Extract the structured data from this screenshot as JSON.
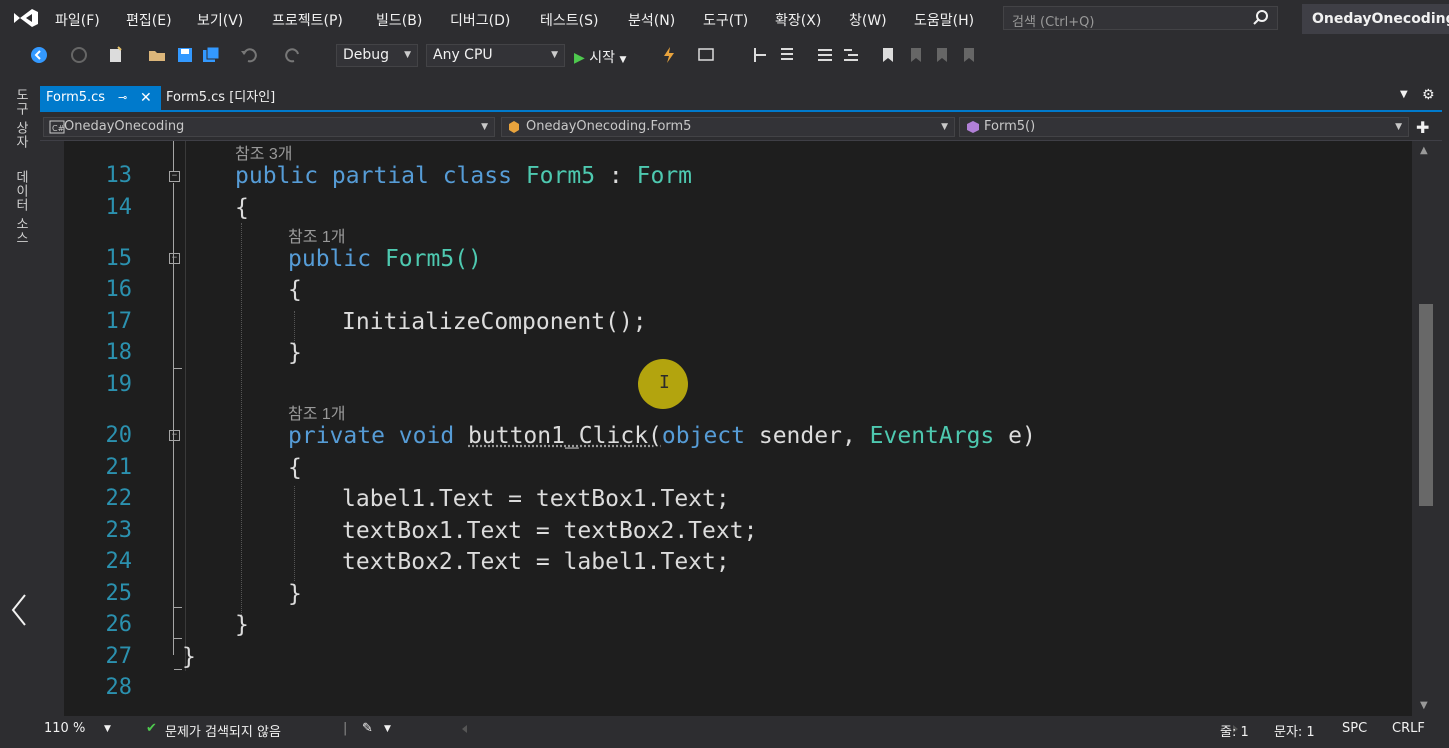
{
  "menubar": {
    "items": [
      "파일(F)",
      "편집(E)",
      "보기(V)",
      "프로젝트(P)",
      "빌드(B)",
      "디버그(D)",
      "테스트(S)",
      "분석(N)",
      "도구(T)",
      "확장(X)",
      "창(W)",
      "도움말(H)"
    ],
    "search_placeholder": "검색 (Ctrl+Q)",
    "project_name": "OnedayOnecoding"
  },
  "toolbar": {
    "config": "Debug",
    "platform": "Any CPU",
    "start_label": "시작"
  },
  "side_tabs": [
    "도구 상자",
    "데이터 소스"
  ],
  "tabs": {
    "active": "Form5.cs",
    "inactive": "Form5.cs [디자인]"
  },
  "navbar": {
    "project": "OnedayOnecoding",
    "class": "OnedayOnecoding.Form5",
    "member": "Form5()"
  },
  "editor": {
    "lines": [
      {
        "num": "13",
        "ref": "참조 3개"
      },
      {
        "num": "14"
      },
      {
        "num": "15",
        "ref": "참조 1개"
      },
      {
        "num": "16"
      },
      {
        "num": "17"
      },
      {
        "num": "18"
      },
      {
        "num": "19"
      },
      {
        "num": "20",
        "ref": "참조 1개"
      },
      {
        "num": "21"
      },
      {
        "num": "22"
      },
      {
        "num": "23"
      },
      {
        "num": "24"
      },
      {
        "num": "25"
      },
      {
        "num": "26"
      },
      {
        "num": "27"
      },
      {
        "num": "28"
      }
    ],
    "code": {
      "l13_kw": "public partial class",
      "l13_name": "Form5",
      "l13_colon": ":",
      "l13_base": "Form",
      "l14": "{",
      "l15_kw": "public",
      "l15_rest": "Form5()",
      "l16": "{",
      "l17": "InitializeComponent();",
      "l18": "}",
      "l20_kw": "private void",
      "l20_name": "button1_Click(",
      "l20_type1": "object",
      "l20_p1": "sender,",
      "l20_type2": "EventArgs",
      "l20_p2": "e)",
      "l21": "{",
      "l22": "label1.Text = textBox1.Text;",
      "l23": "textBox1.Text = textBox2.Text;",
      "l24": "textBox2.Text = label1.Text;",
      "l25": "}",
      "l26": "}",
      "l27": "}"
    }
  },
  "statusbar": {
    "zoom": "110 %",
    "issues": "문제가 검색되지 않음",
    "line": "줄: 1",
    "col": "문자: 1",
    "spacing": "SPC",
    "eol": "CRLF"
  },
  "colors": {
    "accent": "#007acc",
    "keyword": "#569cd6",
    "type": "#4ec9b0",
    "line_number": "#2b91af",
    "cursor_highlight": "#b3a40e"
  }
}
